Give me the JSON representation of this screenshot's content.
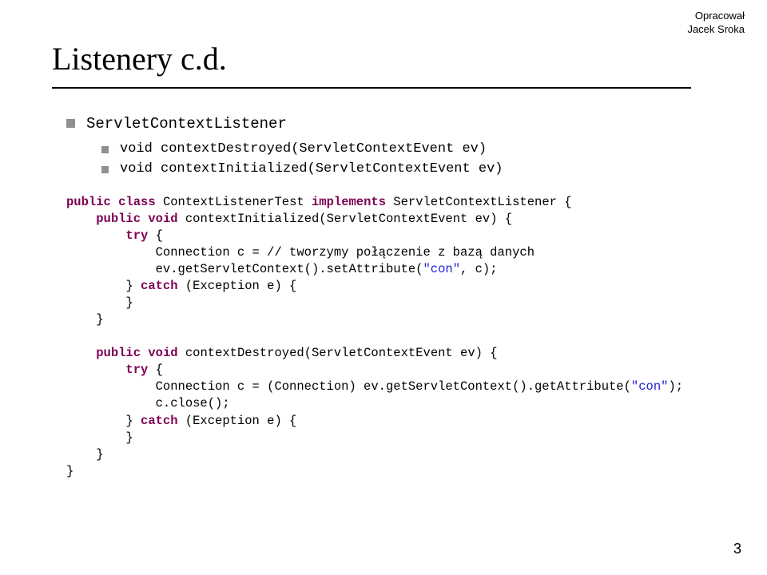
{
  "header": {
    "line1": "Opracował",
    "line2": "Jacek Sroka"
  },
  "title": "Listenery c.d.",
  "bullets": {
    "top": "ServletContextListener",
    "sub1": "void contextDestroyed(ServletContextEvent ev)",
    "sub2": "void contextInitialized(ServletContextEvent ev)"
  },
  "code": {
    "kw": {
      "public": "public",
      "class": "class",
      "implements": "implements",
      "void": "void",
      "try": "try",
      "catch": "catch"
    },
    "str": {
      "con": "\"con\""
    },
    "l1a": " ContextListenerTest ",
    "l1b": " ServletContextListener {",
    "l2": " contextInitialized(ServletContextEvent ev) {",
    "l3": " {",
    "l4": "            Connection c = // tworzymy połączenie z bazą danych",
    "l5a": "            ev.getServletContext().setAttribute(",
    "l5b": ", c);",
    "l6": " (Exception e) {",
    "l7": "        }",
    "l8": "    }",
    "blank": "",
    "l9": " contextDestroyed(ServletContextEvent ev) {",
    "l10": " {",
    "l11": "            Connection c = (Connection) ev.getServletContext().getAttribute(",
    "l11b": ");",
    "l12": "            c.close();",
    "l13": " (Exception e) {",
    "l14": "        }",
    "l15": "    }",
    "l16": "}"
  },
  "pageNumber": "3"
}
